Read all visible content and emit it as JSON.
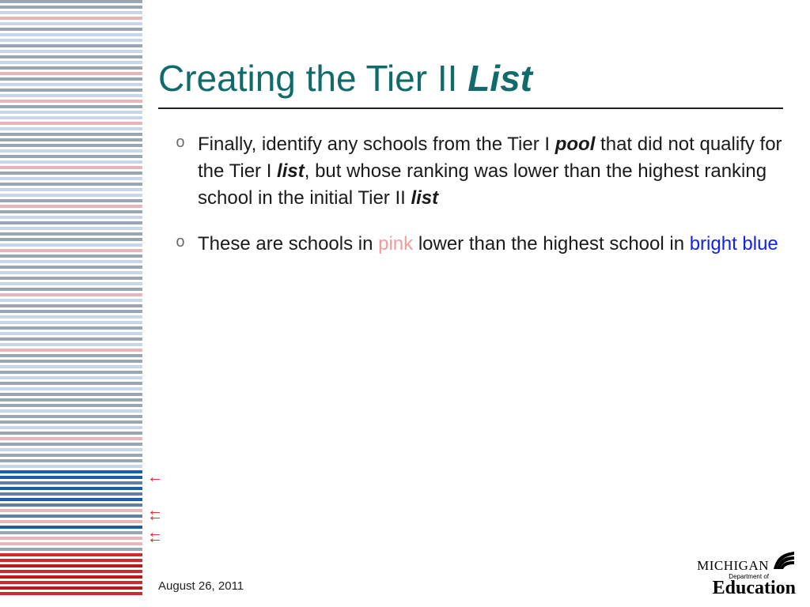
{
  "title": {
    "part1": "Creating the Tier II ",
    "part2_bold_italic": "List"
  },
  "bullets": [
    {
      "runs": [
        {
          "t": "Finally, identify any schools from the Tier I "
        },
        {
          "t": "pool",
          "cls": "bi"
        },
        {
          "t": " that did not qualify for the Tier I "
        },
        {
          "t": "list",
          "cls": "bi"
        },
        {
          "t": ", but whose ranking was lower than the highest ranking school in the initial Tier II "
        },
        {
          "t": "list",
          "cls": "bi"
        }
      ]
    },
    {
      "runs": [
        {
          "t": "These are schools in "
        },
        {
          "t": "pink",
          "cls": "pink"
        },
        {
          "t": " lower than the highest school in "
        },
        {
          "t": "bright blue",
          "cls": "bblue"
        }
      ]
    }
  ],
  "footer_date": "August 26, 2011",
  "brand": {
    "line1": "MICHIGAN",
    "line2": "Department of",
    "line3": "Education"
  },
  "stripe_colors": [
    "#9aa6b2",
    "#9aa6b2",
    "#c7d6e8",
    "#e8b6b9",
    "#c7d6e8",
    "#9aa6b2",
    "#c7d6e8",
    "#c7d6e8",
    "#9aa6b2",
    "#c7d6e8",
    "#9aa6b2",
    "#c7d6e8",
    "#9aa6b2",
    "#e8b6b9",
    "#9aa6b2",
    "#c7d6e8",
    "#9aa6b2",
    "#c7d6e8",
    "#e8b6b9",
    "#9aa6b2",
    "#c7d6e8",
    "#c7d6e8",
    "#e8b6b9",
    "#c7d6e8",
    "#9aa6b2",
    "#9aa6b2",
    "#9aa6b2",
    "#c7d6e8",
    "#9aa6b2",
    "#c7d6e8",
    "#e8b6b9",
    "#9aa6b2",
    "#c7d6e8",
    "#9aa6b2",
    "#c7d6e8",
    "#c7d6e8",
    "#9aa6b2",
    "#e8b6b9",
    "#9aa6b2",
    "#c7d6e8",
    "#9aa6b2",
    "#c7d6e8",
    "#9aa6b2",
    "#9aa6b2",
    "#c7d6e8",
    "#e8b6b9",
    "#9aa6b2",
    "#c7d6e8",
    "#9aa6b2",
    "#c7d6e8",
    "#9aa6b2",
    "#c7d6e8",
    "#9aa6b2",
    "#e8b6b9",
    "#c7d6e8",
    "#9aa6b2",
    "#9aa6b2",
    "#c7d6e8",
    "#c7d6e8",
    "#9aa6b2",
    "#c7d6e8",
    "#9aa6b2",
    "#c7d6e8",
    "#e8b6b9",
    "#9aa6b2",
    "#9aa6b2",
    "#c7d6e8",
    "#9aa6b2",
    "#c7d6e8",
    "#9aa6b2",
    "#c7d6e8",
    "#9aa6b2",
    "#9aa6b2",
    "#9aa6b2",
    "#c7d6e8",
    "#9aa6b2",
    "#9aa6b2",
    "#c7d6e8",
    "#9aa6b2",
    "#e8b6b9",
    "#9aa6b2",
    "#c7d6e8",
    "#9aa6b2",
    "#9aa6b2",
    "#c7d6e8",
    "#1b5fa8",
    "#1b5fa8",
    "#5f7fa7",
    "#1b5fa8",
    "#5f7fa7",
    "#1b5fa8",
    "#5f7fa7",
    "#e8b6b9",
    "#5f7fa7",
    "#e8b6b9",
    "#1b5fa8",
    "#9aa6b2",
    "#e8b6b9",
    "#e8b6b9",
    "#9aa6b2",
    "#d22a2a",
    "#d22a2a",
    "#b71c1c",
    "#d22a2a",
    "#b71c1c",
    "#d22a2a",
    "#b71c1c",
    "#d22a2a"
  ],
  "arrows_at": [
    86,
    92,
    93,
    96,
    97
  ]
}
